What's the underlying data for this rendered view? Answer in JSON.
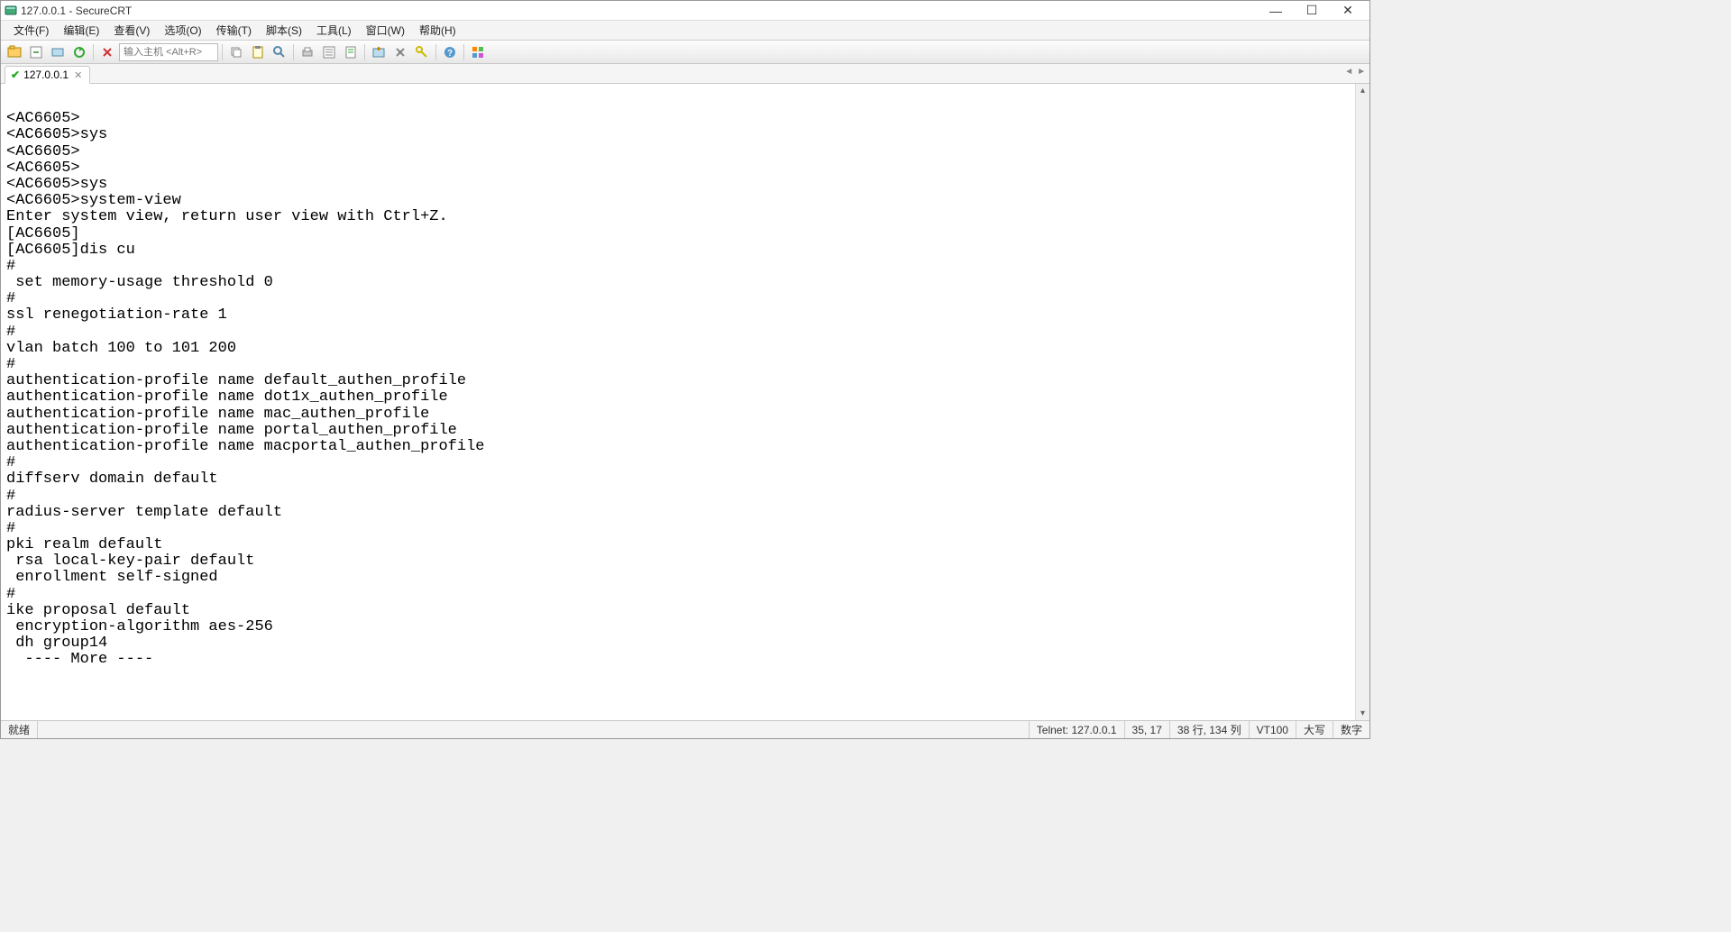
{
  "window": {
    "title": "127.0.0.1 - SecureCRT"
  },
  "menus": {
    "file": "文件(F)",
    "edit": "编辑(E)",
    "view": "查看(V)",
    "options": "选项(O)",
    "transfer": "传输(T)",
    "script": "脚本(S)",
    "tools": "工具(L)",
    "window": "窗口(W)",
    "help": "帮助(H)"
  },
  "toolbar": {
    "host_placeholder": "输入主机 <Alt+R>"
  },
  "tab": {
    "label": "127.0.0.1"
  },
  "terminal_lines": [
    "",
    "<AC6605>",
    "<AC6605>sys",
    "<AC6605>",
    "<AC6605>",
    "<AC6605>sys",
    "<AC6605>system-view",
    "Enter system view, return user view with Ctrl+Z.",
    "[AC6605]",
    "[AC6605]dis cu",
    "#",
    " set memory-usage threshold 0",
    "#",
    "ssl renegotiation-rate 1",
    "#",
    "vlan batch 100 to 101 200",
    "#",
    "authentication-profile name default_authen_profile",
    "authentication-profile name dot1x_authen_profile",
    "authentication-profile name mac_authen_profile",
    "authentication-profile name portal_authen_profile",
    "authentication-profile name macportal_authen_profile",
    "#",
    "diffserv domain default",
    "#",
    "radius-server template default",
    "#",
    "pki realm default",
    " rsa local-key-pair default",
    " enrollment self-signed",
    "#",
    "ike proposal default",
    " encryption-algorithm aes-256",
    " dh group14",
    "  ---- More ----"
  ],
  "status": {
    "ready": "就绪",
    "conn": "Telnet: 127.0.0.1",
    "cursor": "35,  17",
    "size": "38 行, 134 列",
    "term": "VT100",
    "caps": "大写",
    "num": "数字"
  }
}
